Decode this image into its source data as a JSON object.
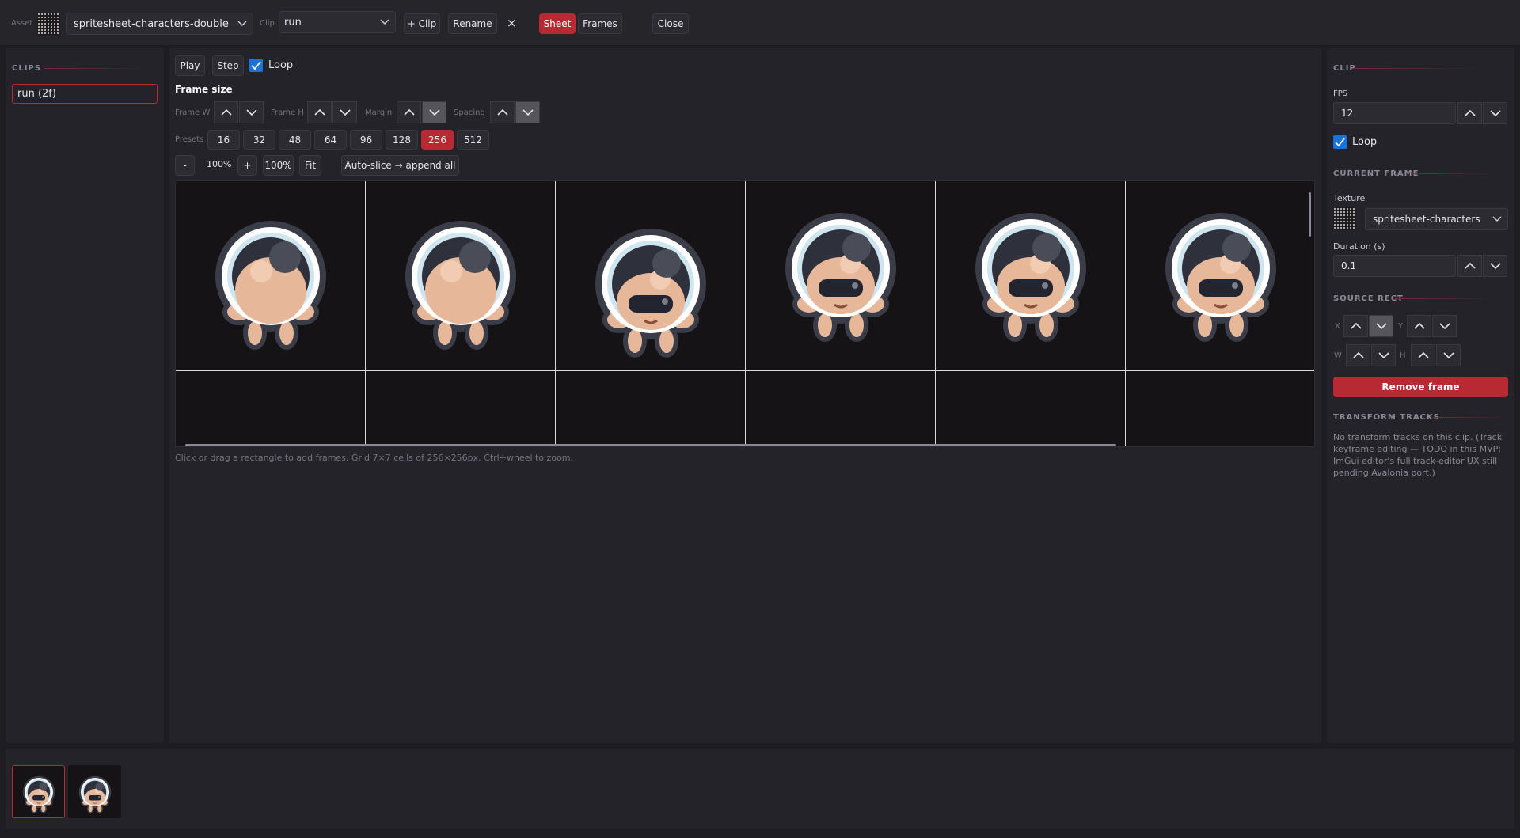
{
  "topbar": {
    "asset_label": "Asset",
    "asset_value": "spritesheet-characters-double",
    "clip_label": "Clip",
    "clip_value": "run",
    "add_clip": "+ Clip",
    "rename": "Rename",
    "delete": "×",
    "tab_sheet": "Sheet",
    "tab_frames": "Frames",
    "close": "Close"
  },
  "clips_panel": {
    "title": "CLIPS",
    "items": [
      {
        "label": "run  (2f)"
      }
    ]
  },
  "playback": {
    "play": "Play",
    "step": "Step",
    "loop": "Loop",
    "loop_checked": true
  },
  "frame_size": {
    "title": "Frame size",
    "frame_w": "Frame W",
    "frame_h": "Frame H",
    "margin": "Margin",
    "spacing": "Spacing",
    "presets_label": "Presets",
    "presets": [
      "16",
      "32",
      "48",
      "64",
      "96",
      "128",
      "256",
      "512"
    ],
    "active_preset": "256"
  },
  "zoom": {
    "minus": "-",
    "value": "100%",
    "plus": "+",
    "reset": "100%",
    "fit": "Fit",
    "auto_slice": "Auto-slice → append all"
  },
  "sheet": {
    "rows_visible": 2,
    "cols_visible": 6,
    "hint": "Click or drag a rectangle to add frames. Grid 7×7 cells of 256×256px. Ctrl+wheel to zoom."
  },
  "clip_panel": {
    "title": "CLIP",
    "fps_label": "FPS",
    "fps_value": "12",
    "loop": "Loop",
    "loop_checked": true,
    "current_frame_title": "CURRENT FRAME",
    "texture_label": "Texture",
    "texture_value": "spritesheet-characters",
    "duration_label": "Duration (s)",
    "duration_value": "0.1",
    "source_rect_title": "SOURCE RECT",
    "x_label": "X",
    "y_label": "Y",
    "w_label": "W",
    "h_label": "H",
    "remove_frame": "Remove frame",
    "transform_title": "TRANSFORM TRACKS",
    "transform_text": "No transform tracks on this clip. (Track keyframe editing — TODO in this MVP; ImGui editor's full track-editor UX still pending Avalonia port.)"
  },
  "colors": {
    "accent": "#b82a33",
    "checkbox": "#1a73d9",
    "background": "#1e1d21",
    "panel": "#24232a"
  },
  "icons": {
    "chevron": "chevron-down-icon",
    "check": "check-icon",
    "sprite": "astronaut-sprite"
  }
}
